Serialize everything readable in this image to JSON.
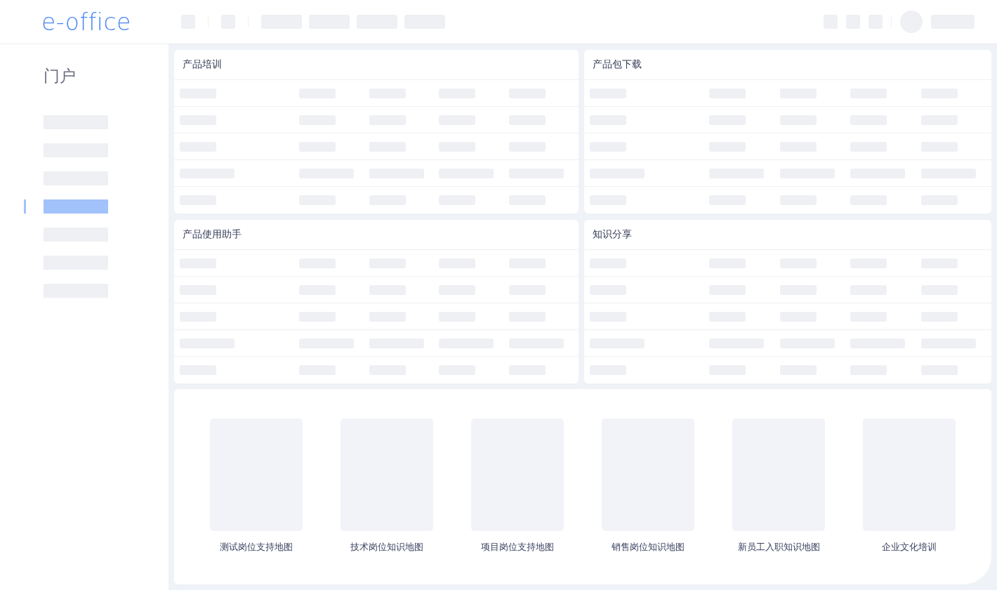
{
  "header": {
    "logo": "e-office"
  },
  "sidebar": {
    "title": "门户",
    "items": [
      {
        "selected": false
      },
      {
        "selected": false
      },
      {
        "selected": false
      },
      {
        "selected": true
      },
      {
        "selected": false
      },
      {
        "selected": false
      },
      {
        "selected": false
      }
    ]
  },
  "panels": [
    {
      "title": "产品培训",
      "rows": [
        {
          "kind": "short"
        },
        {
          "kind": "short"
        },
        {
          "kind": "short"
        },
        {
          "kind": "long"
        },
        {
          "kind": "short"
        }
      ]
    },
    {
      "title": "产品包下载",
      "rows": [
        {
          "kind": "short"
        },
        {
          "kind": "short"
        },
        {
          "kind": "short"
        },
        {
          "kind": "long"
        },
        {
          "kind": "short"
        }
      ]
    },
    {
      "title": "产品使用助手",
      "rows": [
        {
          "kind": "short"
        },
        {
          "kind": "short"
        },
        {
          "kind": "short"
        },
        {
          "kind": "long"
        },
        {
          "kind": "short"
        }
      ]
    },
    {
      "title": "知识分享",
      "rows": [
        {
          "kind": "short"
        },
        {
          "kind": "short"
        },
        {
          "kind": "short"
        },
        {
          "kind": "long"
        },
        {
          "kind": "short"
        }
      ]
    }
  ],
  "maps": [
    {
      "label": "测试岗位支持地图"
    },
    {
      "label": "技术岗位知识地图"
    },
    {
      "label": "项目岗位支持地图"
    },
    {
      "label": "销售岗位知识地图"
    },
    {
      "label": "新员工入职知识地图"
    },
    {
      "label": "企业文化培训"
    }
  ]
}
